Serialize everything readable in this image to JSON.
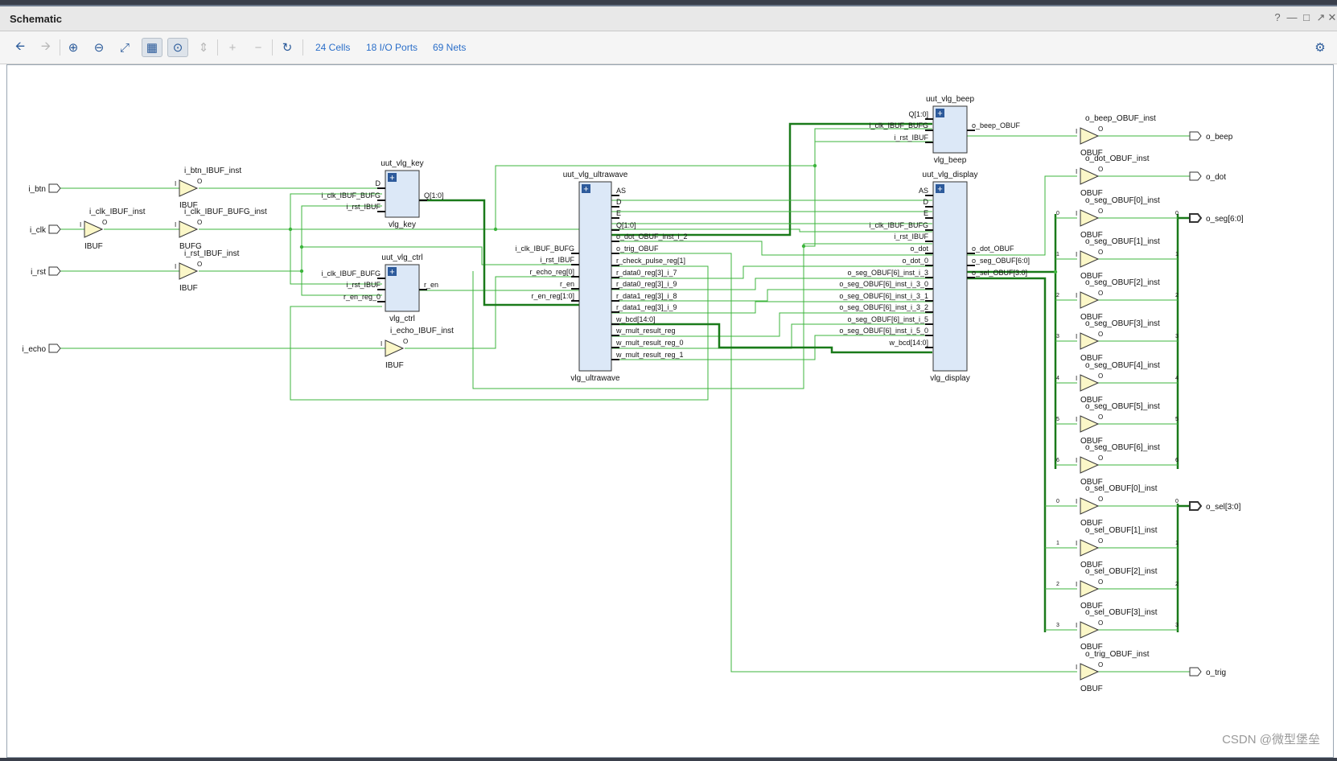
{
  "window": {
    "title": "Schematic"
  },
  "toolbar": {
    "cells": "24 Cells",
    "io_ports": "18 I/O Ports",
    "nets": "69 Nets"
  },
  "ports_in": {
    "btn": "i_btn",
    "clk": "i_clk",
    "rst": "i_rst",
    "echo": "i_echo"
  },
  "ports_out": {
    "beep": "o_beep",
    "dot": "o_dot",
    "seg": "o_seg[6:0]",
    "sel": "o_sel[3:0]",
    "trig": "o_trig"
  },
  "buffers": {
    "i_clk_ibuf": {
      "inst": "i_clk_IBUF_inst",
      "type": "IBUF"
    },
    "i_btn_ibuf": {
      "inst": "i_btn_IBUF_inst",
      "type": "IBUF"
    },
    "i_clk_bufg": {
      "inst": "i_clk_IBUF_BUFG_inst",
      "type": "BUFG"
    },
    "i_rst_ibuf": {
      "inst": "i_rst_IBUF_inst",
      "type": "IBUF"
    },
    "i_echo_ibuf": {
      "inst": "i_echo_IBUF_inst",
      "type": "IBUF"
    },
    "o_beep_obuf": {
      "inst": "o_beep_OBUF_inst",
      "type": "OBUF"
    },
    "o_dot_obuf": {
      "inst": "o_dot_OBUF_inst",
      "type": "OBUF"
    },
    "o_trig_obuf": {
      "inst": "o_trig_OBUF_inst",
      "type": "OBUF"
    }
  },
  "pin_i": "I",
  "pin_o": "O",
  "seg_obufs": [
    {
      "inst": "o_seg_OBUF[0]_inst",
      "type": "OBUF",
      "bit": "0"
    },
    {
      "inst": "o_seg_OBUF[1]_inst",
      "type": "OBUF",
      "bit": "1"
    },
    {
      "inst": "o_seg_OBUF[2]_inst",
      "type": "OBUF",
      "bit": "2"
    },
    {
      "inst": "o_seg_OBUF[3]_inst",
      "type": "OBUF",
      "bit": "3"
    },
    {
      "inst": "o_seg_OBUF[4]_inst",
      "type": "OBUF",
      "bit": "4"
    },
    {
      "inst": "o_seg_OBUF[5]_inst",
      "type": "OBUF",
      "bit": "5"
    },
    {
      "inst": "o_seg_OBUF[6]_inst",
      "type": "OBUF",
      "bit": "6"
    }
  ],
  "sel_obufs": [
    {
      "inst": "o_sel_OBUF[0]_inst",
      "type": "OBUF",
      "bit": "0"
    },
    {
      "inst": "o_sel_OBUF[1]_inst",
      "type": "OBUF",
      "bit": "1"
    },
    {
      "inst": "o_sel_OBUF[2]_inst",
      "type": "OBUF",
      "bit": "2"
    },
    {
      "inst": "o_sel_OBUF[3]_inst",
      "type": "OBUF",
      "bit": "3"
    }
  ],
  "modules": {
    "key": {
      "inst": "uut_vlg_key",
      "type": "vlg_key",
      "inputs": [
        "D",
        "i_clk_IBUF_BUFG",
        "i_rst_IBUF"
      ],
      "outputs": [
        "Q[1:0]"
      ]
    },
    "ctrl": {
      "inst": "uut_vlg_ctrl",
      "type": "vlg_ctrl",
      "inputs": [
        "i_clk_IBUF_BUFG",
        "i_rst_IBUF",
        "r_en_reg_0"
      ],
      "outputs": [
        "r_en"
      ]
    },
    "ultra": {
      "inst": "uut_vlg_ultrawave",
      "type": "vlg_ultrawave",
      "inputs": [
        "i_clk_IBUF_BUFG",
        "i_rst_IBUF",
        "r_echo_reg[0]",
        "r_en",
        "r_en_reg[1:0]"
      ],
      "outputs": [
        "AS",
        "D",
        "E",
        "Q[1:0]",
        "o_dot_OBUF_inst_i_2",
        "o_trig_OBUF",
        "r_check_pulse_reg[1]",
        "r_data0_reg[3]_i_7",
        "r_data0_reg[3]_i_9",
        "r_data1_reg[3]_i_8",
        "r_data1_reg[3]_i_9",
        "w_bcd[14:0]",
        "w_mult_result_reg",
        "w_mult_result_reg_0",
        "w_mult_result_reg_1"
      ]
    },
    "beep": {
      "inst": "uut_vlg_beep",
      "type": "vlg_beep",
      "inputs": [
        "Q[1:0]",
        "i_clk_IBUF_BUFG",
        "i_rst_IBUF"
      ],
      "outputs": [
        "o_beep_OBUF"
      ]
    },
    "display": {
      "inst": "uut_vlg_display",
      "type": "vlg_display",
      "inputs": [
        "AS",
        "D",
        "E",
        "i_clk_IBUF_BUFG",
        "i_rst_IBUF",
        "o_dot",
        "o_dot_0",
        "o_seg_OBUF[6]_inst_i_3",
        "o_seg_OBUF[6]_inst_i_3_0",
        "o_seg_OBUF[6]_inst_i_3_1",
        "o_seg_OBUF[6]_inst_i_3_2",
        "o_seg_OBUF[6]_inst_i_5",
        "o_seg_OBUF[6]_inst_i_5_0",
        "w_bcd[14:0]"
      ],
      "outputs": [
        "o_dot_OBUF",
        "o_seg_OBUF[6:0]",
        "o_sel_OBUF[3:0]"
      ]
    }
  },
  "watermark": "CSDN @微型堡垒",
  "colors": {
    "wire": "#3cb43c",
    "bus": "#1a7a1a",
    "module_fill": "#dce8f7",
    "buffer_fill": "#fbf7c8"
  }
}
